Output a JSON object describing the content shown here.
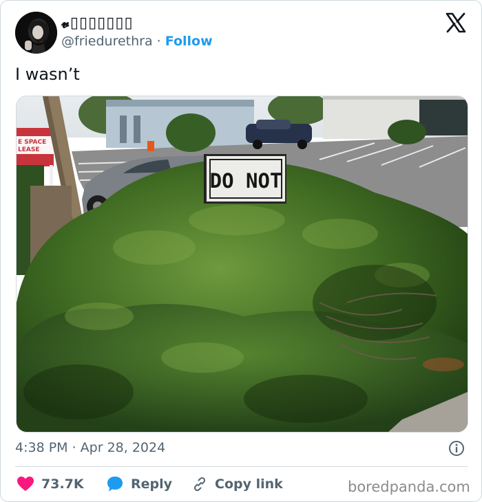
{
  "author": {
    "display_name": "𝓿▯▯▯▯▯▯▯",
    "handle": "@friedurethra",
    "separator": "·",
    "follow_label": "Follow"
  },
  "tweet": {
    "text": "I wasn’t",
    "timestamp": "4:38 PM · Apr 28, 2024"
  },
  "photo": {
    "sign_text": "DO NOT",
    "lease_sign_line1": "E SPACE",
    "lease_sign_line2": "LEASE"
  },
  "actions": {
    "likes_count": "73.7K",
    "reply_label": "Reply",
    "copy_link_label": "Copy link"
  },
  "watermark": "boredpanda.com",
  "colors": {
    "like": "#f91880",
    "reply": "#1d9bf0",
    "link": "#1d9bf0",
    "muted": "#536471"
  },
  "icons": {
    "logo": "x-logo-icon",
    "like": "heart-icon",
    "reply": "speech-bubble-icon",
    "copy_link": "chain-link-icon",
    "info": "info-icon"
  }
}
